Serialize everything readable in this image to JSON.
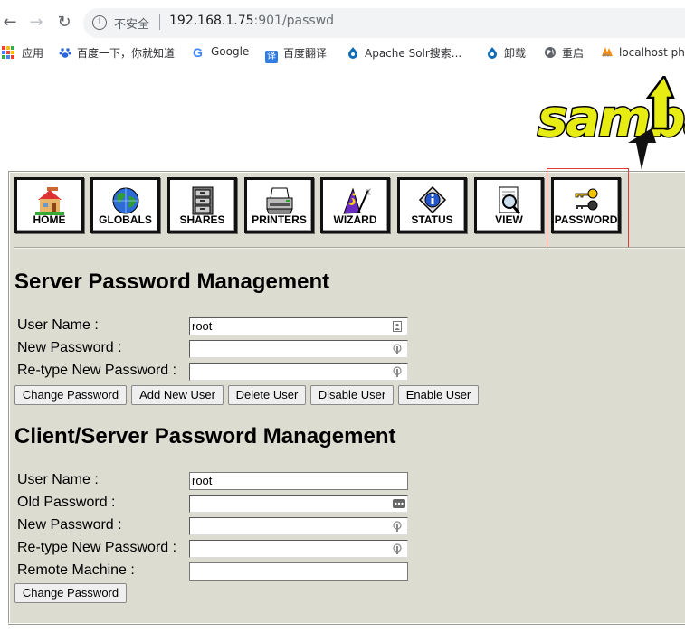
{
  "browser": {
    "insecure_label": "不安全",
    "url_host": "192.168.1.75",
    "url_path": ":901/passwd",
    "bookmarks": [
      {
        "label": "应用",
        "icon": "apps-grid-icon"
      },
      {
        "label": "百度一下，你就知道",
        "icon": "baidu-paw-icon"
      },
      {
        "label": "Google",
        "icon": "google-g-icon"
      },
      {
        "label": "百度翻译",
        "icon": "baidu-translate-icon"
      },
      {
        "label": "Apache Solr搜索...",
        "icon": "drupal-drop-icon"
      },
      {
        "label": "卸载",
        "icon": "drupal-drop-icon"
      },
      {
        "label": "重启",
        "icon": "globe-icon"
      },
      {
        "label": "localhost ph",
        "icon": "phpmyadmin-icon"
      }
    ]
  },
  "logo": {
    "text": "samba"
  },
  "toolbar": {
    "buttons": [
      {
        "label": "HOME",
        "icon": "house-icon"
      },
      {
        "label": "GLOBALS",
        "icon": "globe-icon"
      },
      {
        "label": "SHARES",
        "icon": "file-cabinet-icon"
      },
      {
        "label": "PRINTERS",
        "icon": "printer-icon"
      },
      {
        "label": "WIZARD",
        "icon": "wizard-hat-icon"
      },
      {
        "label": "STATUS",
        "icon": "info-badge-icon"
      },
      {
        "label": "VIEW",
        "icon": "magnifier-icon"
      },
      {
        "label": "PASSWORD",
        "icon": "keys-icon"
      }
    ]
  },
  "server": {
    "heading": "Server Password Management",
    "user_name_label": "User Name :",
    "user_name_value": "root",
    "new_password_label": "New Password :",
    "retype_label": "Re-type New Password :",
    "buttons": {
      "change": "Change Password",
      "add": "Add New User",
      "delete": "Delete User",
      "disable": "Disable User",
      "enable": "Enable User"
    }
  },
  "client": {
    "heading": "Client/Server Password Management",
    "user_name_label": "User Name :",
    "user_name_value": "root",
    "old_password_label": "Old Password :",
    "new_password_label": "New Password :",
    "retype_label": "Re-type New Password :",
    "remote_label": "Remote Machine :",
    "change_button": "Change Password"
  }
}
